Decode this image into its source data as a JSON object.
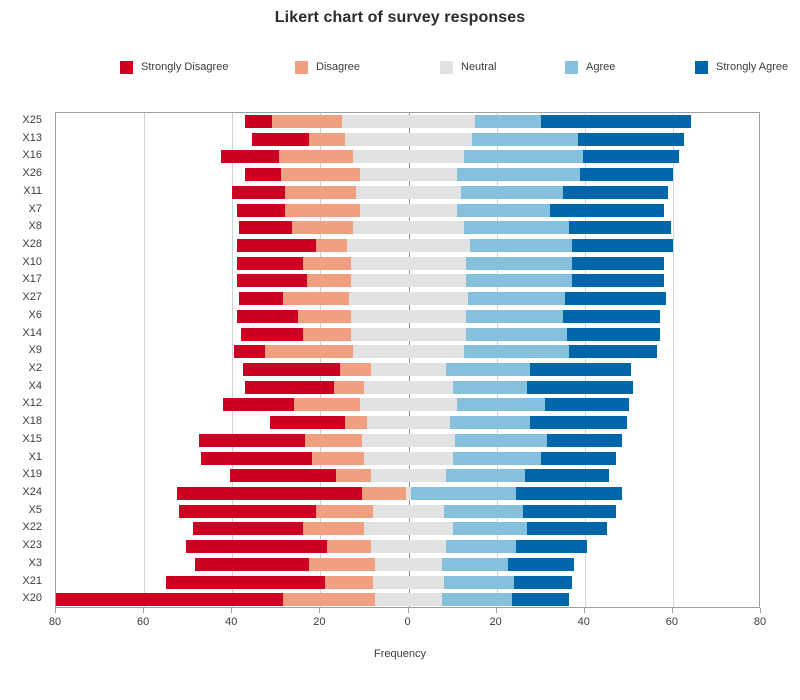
{
  "title": "Likert chart of survey responses",
  "legend": {
    "position": "top",
    "items": [
      {
        "label": "Strongly Disagree",
        "color": "#cc0022"
      },
      {
        "label": "Disagree",
        "color": "#f0a080"
      },
      {
        "label": "Neutral",
        "color": "#e2e2e2"
      },
      {
        "label": "Agree",
        "color": "#85c1dd"
      },
      {
        "label": "Strongly Agree",
        "color": "#0066aa"
      }
    ]
  },
  "axes": {
    "x": {
      "label": "Frequency",
      "ticks": [
        "80",
        "60",
        "40",
        "20",
        "0",
        "20",
        "40",
        "60",
        "80"
      ],
      "tick_values": [
        -80,
        -60,
        -40,
        -20,
        0,
        20,
        40,
        60,
        80
      ],
      "min": -80,
      "max": 80
    },
    "y": {
      "label": ""
    }
  },
  "chart_data": {
    "type": "bar",
    "subtype": "diverging-stacked-likert",
    "title": "Likert chart of survey responses",
    "xlabel": "Frequency",
    "ylabel": "",
    "xlim": [
      -80,
      80
    ],
    "grid": true,
    "legend_position": "top",
    "categories": [
      "X25",
      "X13",
      "X16",
      "X26",
      "X11",
      "X7",
      "X8",
      "X28",
      "X10",
      "X17",
      "X27",
      "X6",
      "X14",
      "X9",
      "X2",
      "X4",
      "X12",
      "X18",
      "X15",
      "X1",
      "X19",
      "X24",
      "X5",
      "X22",
      "X23",
      "X3",
      "X21",
      "X20"
    ],
    "series": [
      {
        "name": "Strongly Disagree",
        "color": "#cc0022",
        "values": [
          6,
          13,
          13,
          8,
          12,
          11,
          12,
          18,
          15,
          16,
          10,
          14,
          14,
          7,
          22,
          20,
          16,
          17,
          24,
          25,
          24,
          42,
          31,
          25,
          32,
          26,
          36,
          53
        ]
      },
      {
        "name": "Disagree",
        "color": "#f0a080",
        "values": [
          16,
          8,
          17,
          18,
          16,
          17,
          14,
          7,
          11,
          10,
          15,
          12,
          11,
          20,
          7,
          7,
          15,
          5,
          13,
          12,
          8,
          10,
          13,
          14,
          10,
          15,
          11,
          21
        ]
      },
      {
        "name": "Neutral",
        "color": "#e2e2e2",
        "values": [
          30,
          29,
          25,
          22,
          24,
          22,
          25,
          28,
          26,
          26,
          27,
          26,
          26,
          25,
          17,
          20,
          22,
          19,
          21,
          20,
          17,
          1,
          16,
          20,
          17,
          15,
          16,
          15
        ]
      },
      {
        "name": "Agree",
        "color": "#85c1dd",
        "values": [
          15,
          24,
          27,
          28,
          23,
          21,
          24,
          23,
          24,
          24,
          22,
          22,
          23,
          24,
          19,
          17,
          20,
          18,
          21,
          20,
          18,
          24,
          18,
          17,
          16,
          15,
          16,
          16
        ]
      },
      {
        "name": "Strongly Agree",
        "color": "#0066aa",
        "values": [
          34,
          24,
          22,
          21,
          24,
          26,
          23,
          23,
          21,
          21,
          23,
          22,
          21,
          20,
          23,
          24,
          19,
          22,
          17,
          17,
          19,
          24,
          21,
          18,
          16,
          15,
          13,
          13
        ]
      }
    ],
    "neutral_split": "half-left-half-right"
  }
}
